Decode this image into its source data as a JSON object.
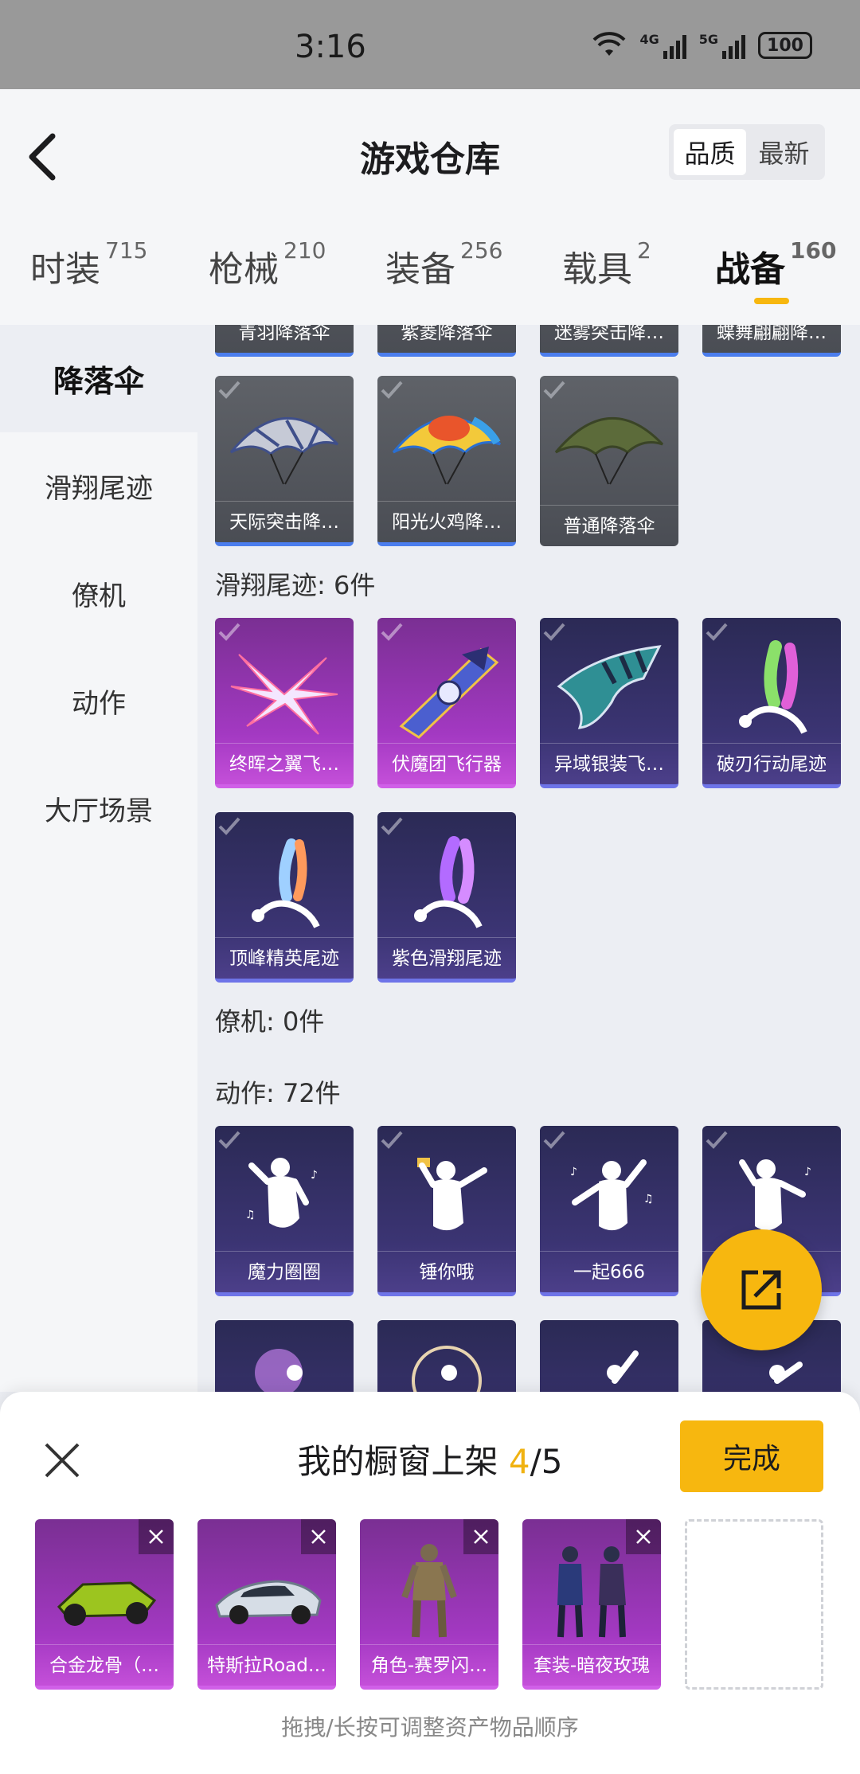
{
  "status": {
    "time": "3:16",
    "net1": "4G",
    "net2": "5G",
    "battery": "100"
  },
  "header": {
    "title": "游戏仓库",
    "sort": {
      "quality": "品质",
      "newest": "最新"
    },
    "categories": [
      {
        "label": "时装",
        "count": "715"
      },
      {
        "label": "枪械",
        "count": "210"
      },
      {
        "label": "装备",
        "count": "256"
      },
      {
        "label": "载具",
        "count": "2"
      },
      {
        "label": "战备",
        "count": "160"
      }
    ]
  },
  "leftnav": [
    "降落伞",
    "滑翔尾迹",
    "僚机",
    "动作",
    "大厅场景"
  ],
  "content": {
    "partial_row": [
      "青羽降落伞",
      "紫菱降落伞",
      "迷雾突击降…",
      "蝶舞翩翩降…"
    ],
    "parachutes": [
      "天际突击降…",
      "阳光火鸡降…",
      "普通降落伞"
    ],
    "trail_header": "滑翔尾迹: 6件",
    "trails": [
      "终晖之翼飞…",
      "伏魔团飞行器",
      "异域银装飞…",
      "破刃行动尾迹",
      "顶峰精英尾迹",
      "紫色滑翔尾迹"
    ],
    "wingman_header": "僚机: 0件",
    "action_header": "动作: 72件",
    "actions": [
      "魔力圈圈",
      "锤你哦",
      "一起666",
      ""
    ]
  },
  "sheet": {
    "title_prefix": "我的橱窗上架 ",
    "count": "4",
    "total": "/5",
    "done": "完成",
    "items": [
      "合金龙骨（…",
      "特斯拉Road…",
      "角色-赛罗闪…",
      "套装-暗夜玫瑰"
    ],
    "hint": "拖拽/长按可调整资产物品顺序"
  },
  "colors": {
    "accent": "#f7b70f",
    "purple": "#a339c2",
    "navy": "#3b3473",
    "blue_underline": "#4b7ded"
  }
}
